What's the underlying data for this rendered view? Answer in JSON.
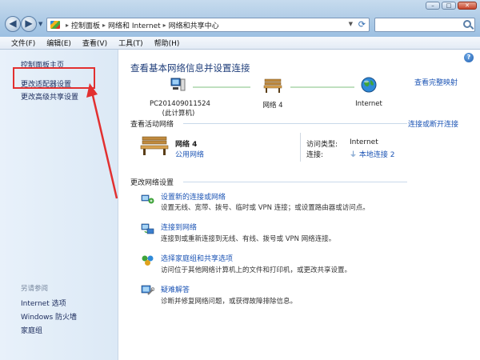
{
  "address": {
    "crumbs": [
      "控制面板",
      "网络和 Internet",
      "网络和共享中心"
    ]
  },
  "menu": [
    {
      "label": "文件(F)"
    },
    {
      "label": "编辑(E)"
    },
    {
      "label": "查看(V)"
    },
    {
      "label": "工具(T)"
    },
    {
      "label": "帮助(H)"
    }
  ],
  "sidebar": {
    "items": [
      {
        "label": "控制面板主页"
      },
      {
        "label": "更改适配器设置"
      },
      {
        "label": "更改高级共享设置"
      }
    ],
    "see_also_title": "另请参阅",
    "see_also": [
      {
        "label": "Internet 选项"
      },
      {
        "label": "Windows 防火墙"
      },
      {
        "label": "家庭组"
      }
    ]
  },
  "main": {
    "title": "查看基本网络信息并设置连接",
    "view_full_map": "查看完整映射",
    "nodes": [
      {
        "name": "PC201409011524",
        "sub": "(此计算机)"
      },
      {
        "name": "网络 4"
      },
      {
        "name": "Internet"
      }
    ],
    "active_networks": {
      "header": "查看活动网络",
      "connect_disconnect": "连接或断开连接",
      "network_name": "网络 4",
      "network_type": "公用网络",
      "access_type_label": "访问类型:",
      "access_type_value": "Internet",
      "connections_label": "连接:",
      "connections_value": "本地连接 2"
    },
    "change_settings": {
      "header": "更改网络设置",
      "tasks": [
        {
          "title": "设置新的连接或网络",
          "desc": "设置无线、宽带、拨号、临时或 VPN 连接；或设置路由器或访问点。"
        },
        {
          "title": "连接到网络",
          "desc": "连接到或重新连接到无线、有线、拨号或 VPN 网络连接。"
        },
        {
          "title": "选择家庭组和共享选项",
          "desc": "访问位于其他网络计算机上的文件和打印机，或更改共享设置。"
        },
        {
          "title": "疑难解答",
          "desc": "诊断并修复网络问题，或获得故障排除信息。"
        }
      ]
    }
  },
  "colors": {
    "link": "#1d55b5",
    "annotation": "#e23030"
  }
}
